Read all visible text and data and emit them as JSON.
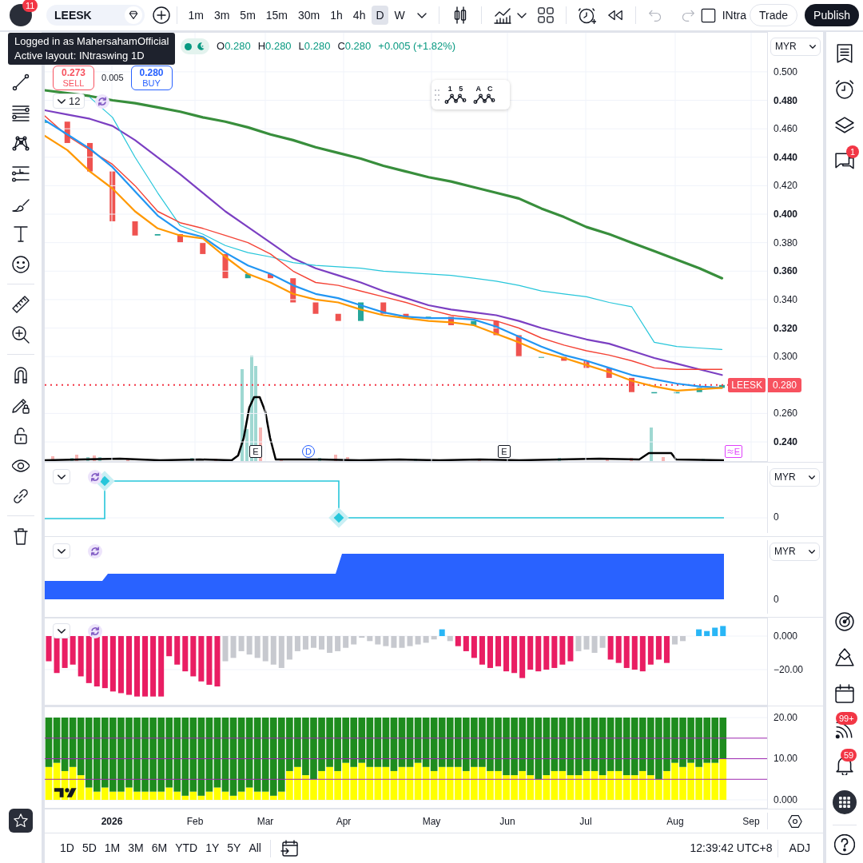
{
  "toolbar": {
    "avatar_badge": "11",
    "symbol": "LEESK",
    "intervals": [
      {
        "label": "1m",
        "selected": false
      },
      {
        "label": "3m",
        "selected": false
      },
      {
        "label": "5m",
        "selected": false
      },
      {
        "label": "15m",
        "selected": false
      },
      {
        "label": "30m",
        "selected": false
      },
      {
        "label": "1h",
        "selected": false
      },
      {
        "label": "4h",
        "selected": false
      },
      {
        "label": "D",
        "selected": true
      },
      {
        "label": "W",
        "selected": false
      }
    ],
    "undo": {
      "disabled": true
    },
    "redo": {
      "disabled": true
    },
    "layout_name": "INtra",
    "trade_button": "Trade",
    "publish_button": "Publish"
  },
  "tooltip": {
    "lines": [
      "Logged in as MahersahamOfficial",
      "Active layout: INtraswing 1D"
    ]
  },
  "legend": {
    "ohlc": [
      {
        "label": "O",
        "value": "0.280"
      },
      {
        "label": "H",
        "value": "0.280"
      },
      {
        "label": "L",
        "value": "0.280"
      },
      {
        "label": "C",
        "value": "0.280"
      }
    ],
    "change": "+0.005 (+1.82%)"
  },
  "trade_panel": {
    "sell_price": "0.273",
    "sell_label": "SELL",
    "spread": "0.005",
    "buy_price": "0.280",
    "buy_label": "BUY"
  },
  "drawing_toolbar": {
    "buttons": [
      {
        "label": "1 5"
      },
      {
        "label": "A C"
      }
    ]
  },
  "main_pane": {
    "currency": "MYR",
    "indicator_count": "12",
    "last_price": {
      "symbol": "LEESK",
      "value": "0.280"
    },
    "chart_data": {
      "type": "line",
      "grid": true,
      "categories": [
        null,
        null,
        null,
        null,
        null,
        null,
        null,
        null,
        null,
        null,
        null,
        null,
        null,
        null,
        null,
        null,
        null,
        null,
        null,
        null,
        null,
        null,
        null,
        null,
        null,
        null,
        null,
        null,
        null,
        null,
        null,
        null
      ],
      "ylim": [
        0.226,
        0.528
      ],
      "yticks": [
        {
          "value": 0.5,
          "label": "0.500"
        },
        {
          "value": 0.48,
          "label": "0.480"
        },
        {
          "value": 0.46,
          "label": "0.460"
        },
        {
          "value": 0.44,
          "label": "0.440"
        },
        {
          "value": 0.42,
          "label": "0.420"
        },
        {
          "value": 0.4,
          "label": "0.400"
        },
        {
          "value": 0.38,
          "label": "0.380"
        },
        {
          "value": 0.36,
          "label": "0.360"
        },
        {
          "value": 0.34,
          "label": "0.340"
        },
        {
          "value": 0.32,
          "label": "0.320"
        },
        {
          "value": 0.3,
          "label": "0.300"
        },
        {
          "value": 0.26,
          "label": "0.260"
        },
        {
          "value": 0.24,
          "label": "0.240"
        }
      ],
      "series": [
        {
          "color": "#388e3c",
          "values": [
            0.487,
            0.485,
            0.483,
            0.48,
            0.478,
            0.475,
            0.472,
            0.468,
            0.465,
            0.461,
            0.456,
            0.452,
            0.447,
            0.443,
            0.439,
            0.434,
            0.43,
            0.426,
            0.423,
            0.419,
            0.415,
            0.411,
            0.404,
            0.398,
            0.391,
            0.386,
            0.38,
            0.374,
            0.368,
            0.362,
            0.355,
            null
          ]
        },
        {
          "color": "#7b3fc2",
          "values": [
            0.473,
            0.47,
            0.467,
            0.462,
            0.452,
            0.44,
            0.428,
            0.415,
            0.402,
            0.391,
            0.38,
            0.369,
            0.362,
            0.357,
            0.352,
            0.346,
            0.341,
            0.336,
            0.333,
            0.331,
            0.329,
            0.325,
            0.32,
            0.316,
            0.312,
            0.309,
            0.304,
            0.299,
            0.295,
            0.291,
            0.287,
            null
          ]
        },
        {
          "color": "#26c6da",
          "values": [
            null,
            null,
            0.482,
            0.468,
            0.44,
            0.415,
            0.392,
            0.386,
            0.378,
            0.373,
            0.37,
            0.366,
            0.364,
            0.363,
            0.362,
            0.36,
            0.359,
            0.358,
            0.357,
            0.355,
            0.353,
            0.35,
            0.346,
            0.344,
            0.342,
            0.338,
            0.335,
            0.31,
            0.307,
            0.306,
            0.305,
            null
          ]
        },
        {
          "color": "#f44336",
          "values": [
            0.469,
            0.455,
            0.445,
            0.435,
            0.42,
            0.402,
            0.394,
            0.39,
            0.385,
            0.38,
            0.372,
            0.36,
            0.352,
            0.35,
            0.346,
            0.342,
            0.338,
            0.333,
            0.329,
            0.327,
            0.325,
            0.32,
            0.313,
            0.308,
            0.304,
            0.301,
            0.297,
            0.292,
            0.291,
            0.291,
            0.291,
            null
          ]
        },
        {
          "color": "#2196f3",
          "values": [
            0.466,
            0.456,
            0.446,
            0.433,
            0.416,
            0.399,
            0.388,
            0.384,
            0.373,
            0.364,
            0.358,
            0.35,
            0.344,
            0.341,
            0.336,
            0.331,
            0.328,
            0.327,
            0.327,
            0.326,
            0.321,
            0.314,
            0.307,
            0.301,
            0.297,
            0.292,
            0.287,
            0.284,
            0.281,
            0.279,
            0.278,
            null
          ]
        },
        {
          "color": "#ff9800",
          "values": [
            0.455,
            0.445,
            0.43,
            0.418,
            0.402,
            0.39,
            0.385,
            0.383,
            0.37,
            0.358,
            0.352,
            0.344,
            0.34,
            0.338,
            0.333,
            0.329,
            0.327,
            0.325,
            0.324,
            0.322,
            0.316,
            0.31,
            0.303,
            0.299,
            0.294,
            0.289,
            0.283,
            0.279,
            0.276,
            0.277,
            0.278,
            null
          ]
        }
      ]
    },
    "events": [
      {
        "kind": "earnings",
        "label": "E"
      },
      {
        "kind": "dividend",
        "label": "D"
      },
      {
        "kind": "earnings",
        "label": "E"
      },
      {
        "kind": "upcoming_earnings",
        "label": "E"
      }
    ]
  },
  "panes": [
    {
      "kind": "step_line",
      "currency": "MYR",
      "scale_label": "0"
    },
    {
      "kind": "area",
      "currency": "MYR",
      "scale_label": "0"
    },
    {
      "kind": "histogram",
      "chart_data": {
        "type": "bar",
        "grid": true,
        "ylim": [
          -41.4,
          10.95
        ],
        "yticks": [
          {
            "value": 0,
            "label": "0.000"
          },
          {
            "value": -20,
            "label": "−20.00"
          }
        ],
        "series": [
          {
            "color": "#e91e63",
            "values": [
              -15,
              -22,
              -19,
              -17,
              -24,
              -28,
              -30,
              -31,
              -33,
              -34,
              -35,
              -36,
              -36,
              -36,
              -36,
              -12,
              -17,
              -21,
              -24,
              -27,
              -29,
              -30,
              null,
              null,
              null,
              null,
              null,
              null,
              null,
              null,
              null,
              null,
              null,
              null,
              null,
              null,
              null,
              null,
              null,
              null,
              null,
              null,
              null,
              null,
              null,
              null,
              null,
              null,
              null,
              null,
              null,
              -6,
              -9,
              -13,
              -17,
              -19,
              -18,
              -21,
              -22,
              -25,
              -20,
              -21,
              -20,
              -19,
              -17,
              -15,
              null,
              null,
              null,
              null,
              -14,
              -16,
              -19,
              -20,
              -21,
              -17,
              -14,
              -16,
              null,
              null,
              null,
              null,
              null,
              null,
              null,
              null,
              null,
              null,
              null,
              null
            ]
          },
          {
            "color": "#c7c9cf",
            "values": [
              null,
              null,
              null,
              null,
              null,
              null,
              null,
              null,
              null,
              null,
              null,
              null,
              null,
              null,
              null,
              null,
              null,
              null,
              null,
              null,
              null,
              null,
              -15,
              -13,
              -9,
              -11,
              -13,
              -15,
              -17,
              -19,
              -14,
              -9,
              -8,
              -7,
              -8,
              -10,
              -9,
              -7,
              -5,
              -1,
              -3,
              -5,
              -6,
              -7,
              -7,
              -6,
              -5,
              -4,
              -2,
              null,
              -3,
              null,
              null,
              null,
              null,
              null,
              null,
              null,
              null,
              null,
              null,
              null,
              null,
              null,
              null,
              null,
              -9,
              -8,
              -10,
              -7,
              null,
              null,
              null,
              null,
              null,
              null,
              null,
              null,
              -5,
              -3,
              null,
              null,
              null,
              null,
              null,
              null,
              null,
              null,
              null,
              null
            ]
          },
          {
            "color": "#29b6f6",
            "values": [
              null,
              null,
              null,
              null,
              null,
              null,
              null,
              null,
              null,
              null,
              null,
              null,
              null,
              null,
              null,
              null,
              null,
              null,
              null,
              null,
              null,
              null,
              null,
              null,
              null,
              null,
              null,
              null,
              null,
              null,
              null,
              null,
              null,
              null,
              null,
              null,
              null,
              null,
              null,
              null,
              null,
              null,
              null,
              null,
              null,
              null,
              null,
              null,
              null,
              4,
              null,
              null,
              null,
              null,
              null,
              null,
              null,
              null,
              null,
              null,
              null,
              null,
              null,
              null,
              null,
              null,
              null,
              null,
              null,
              null,
              null,
              null,
              null,
              null,
              null,
              null,
              null,
              null,
              null,
              null,
              null,
              4,
              3,
              5,
              6,
              null,
              null,
              null,
              null,
              null
            ]
          }
        ]
      }
    },
    {
      "kind": "bars",
      "chart_data": {
        "type": "bar",
        "grid": true,
        "stacked": true,
        "ylim": [
          -2.14,
          22.72
        ],
        "yticks": [
          {
            "value": 20,
            "label": "20.00"
          },
          {
            "value": 10,
            "label": "10.00"
          },
          {
            "value": 0,
            "label": "0.000"
          }
        ],
        "series": [
          {
            "color": "#ffff00",
            "values": [
              8,
              9,
              7,
              8,
              6,
              3,
              2,
              3,
              2,
              2,
              3,
              2,
              2,
              2,
              2,
              3,
              2,
              1,
              2,
              1,
              2,
              3,
              2,
              1,
              2,
              3,
              2,
              2,
              1,
              2,
              7,
              8,
              6,
              5,
              7,
              8,
              7,
              9,
              8,
              9,
              8,
              8,
              8,
              7,
              8,
              8,
              9,
              8,
              7,
              8,
              8,
              8,
              7,
              8,
              8,
              7,
              7,
              6,
              6,
              7,
              6,
              5,
              6,
              7,
              7,
              6,
              6,
              7,
              7,
              6,
              7,
              7,
              6,
              6,
              7,
              6,
              5,
              7,
              9,
              8,
              9,
              8,
              9,
              9,
              10,
              null,
              null,
              null,
              null,
              null
            ]
          },
          {
            "color": "#1e8c1e",
            "values": [
              12,
              11,
              13,
              12,
              14,
              17,
              18,
              17,
              18,
              18,
              17,
              18,
              18,
              18,
              18,
              17,
              18,
              19,
              18,
              19,
              18,
              17,
              18,
              19,
              18,
              17,
              18,
              18,
              19,
              18,
              13,
              12,
              14,
              15,
              13,
              12,
              13,
              11,
              12,
              11,
              12,
              12,
              12,
              13,
              12,
              12,
              11,
              12,
              13,
              12,
              12,
              12,
              13,
              12,
              12,
              13,
              13,
              14,
              14,
              13,
              14,
              15,
              14,
              13,
              13,
              14,
              14,
              13,
              13,
              14,
              13,
              13,
              14,
              14,
              13,
              14,
              15,
              13,
              11,
              12,
              11,
              12,
              11,
              11,
              10,
              null,
              null,
              null,
              null,
              null
            ]
          }
        ],
        "ref_lines": [
          {
            "axis": "y",
            "value": 15
          },
          {
            "axis": "y",
            "value": 10
          },
          {
            "axis": "y",
            "value": 5
          }
        ]
      }
    }
  ],
  "time_axis": {
    "labels": [
      {
        "label": "2026",
        "kind": "year"
      },
      {
        "label": "Feb",
        "kind": "month"
      },
      {
        "label": "Mar",
        "kind": "month"
      },
      {
        "label": "Apr",
        "kind": "month"
      },
      {
        "label": "May",
        "kind": "month"
      },
      {
        "label": "Jun",
        "kind": "month"
      },
      {
        "label": "Jul",
        "kind": "month"
      },
      {
        "label": "Aug",
        "kind": "month"
      },
      {
        "label": "Sep",
        "kind": "month"
      }
    ]
  },
  "right_sidebar": {
    "chat_badge": "1",
    "feed_badge": "99+",
    "alerts_badge": "59"
  },
  "range_bar": {
    "ranges": [
      {
        "label": "1D",
        "selected": false
      },
      {
        "label": "5D",
        "selected": false
      },
      {
        "label": "1M",
        "selected": false
      },
      {
        "label": "3M",
        "selected": false
      },
      {
        "label": "6M",
        "selected": false
      },
      {
        "label": "YTD",
        "selected": false
      },
      {
        "label": "1Y",
        "selected": false
      },
      {
        "label": "5Y",
        "selected": false
      },
      {
        "label": "All",
        "selected": false
      }
    ],
    "clock": "12:39:42 UTC+8",
    "adjust": "ADJ"
  }
}
